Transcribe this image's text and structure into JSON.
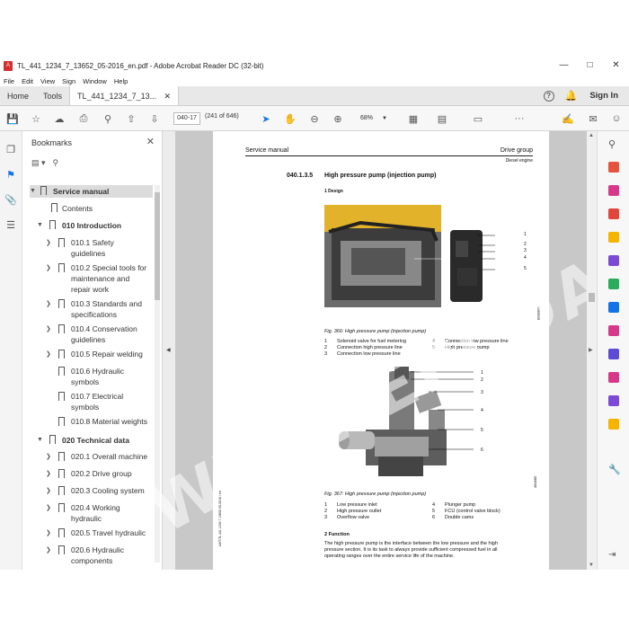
{
  "window": {
    "title": "TL_441_1234_7_13652_05-2016_en.pdf - Adobe Acrobat Reader DC (32-bit)"
  },
  "menu": [
    "File",
    "Edit",
    "View",
    "Sign",
    "Window",
    "Help"
  ],
  "tabs": {
    "home": "Home",
    "tools": "Tools",
    "doc": "TL_441_1234_7_13..."
  },
  "account": {
    "signin": "Sign In"
  },
  "toolbar": {
    "page_value": "040-17",
    "page_of": "(241 of 646)",
    "zoom": "68%"
  },
  "bookmarks": {
    "heading": "Bookmarks",
    "items": [
      {
        "label": "Service manual"
      },
      {
        "label": "Contents"
      },
      {
        "label": "010 Introduction"
      },
      {
        "label": "010.1 Safety"
      },
      {
        "label": "guidelines"
      },
      {
        "label": "010.2 Special tools for"
      },
      {
        "label": "maintenance and"
      },
      {
        "label": "repair work"
      },
      {
        "label": "010.3 Standards and"
      },
      {
        "label": "specifications"
      },
      {
        "label": "010.4 Conservation"
      },
      {
        "label": "guidelines"
      },
      {
        "label": "010.5 Repair welding"
      },
      {
        "label": "010.6 Hydraulic"
      },
      {
        "label": "symbols"
      },
      {
        "label": "010.7 Electrical"
      },
      {
        "label": "symbols"
      },
      {
        "label": "010.8 Material weights"
      },
      {
        "label": "020 Technical data"
      },
      {
        "label": "020.1 Overall machine"
      },
      {
        "label": "020.2 Drive group"
      },
      {
        "label": "020.3 Cooling system"
      },
      {
        "label": "020.4 Working"
      },
      {
        "label": "hydraulic"
      },
      {
        "label": "020.5 Travel hydraulic"
      },
      {
        "label": "020.6 Hydraulic"
      },
      {
        "label": "components"
      }
    ]
  },
  "page": {
    "header_left": "Service manual",
    "header_right": "Drive group",
    "header_sub": "Diesel engine",
    "section_num": "040.1.3.5",
    "section_title": "High pressure pump (injection pump)",
    "sub1": "1 Design",
    "fig1_caption": "Fig. 366: High pressure pump (injection pump)",
    "fig1_legend": [
      [
        "1",
        "Solenoid valve for fuel metering"
      ],
      [
        "2",
        "Connection high pressure line"
      ],
      [
        "3",
        "Connection low pressure line"
      ],
      [
        "4",
        "Connection low pressure line"
      ],
      [
        "5",
        "High pressure pump"
      ]
    ],
    "fig2_caption": "Fig. 367: High pressure pump (injection pump)",
    "fig2_legend": [
      [
        "1",
        "Low pressure inlet"
      ],
      [
        "2",
        "High pressure outlet"
      ],
      [
        "3",
        "Overflow valve"
      ],
      [
        "4",
        "Plunger pump"
      ],
      [
        "5",
        "FCU (control valve block)"
      ],
      [
        "6",
        "Double cams"
      ]
    ],
    "sub2": "2 Function",
    "function_text_1": "The high pressure pump is the interface between the low pressure and the high",
    "function_text_2": "pressure section. It is its task to always provide sufficient compressed fuel in all",
    "function_text_3": "operating ranges over the entire service life of the machine.",
    "fig1_code": "8208802",
    "fig2_code": "400885",
    "side_code": "LWT/TL 441 1234 7 13652 05-2016 / en"
  },
  "watermark": "WWW.EPCDATA.COM",
  "colors": {
    "acrobat_red": "#d32f2f",
    "accent_blue": "#1473e6",
    "doc_bg": "#c8c8c8"
  }
}
